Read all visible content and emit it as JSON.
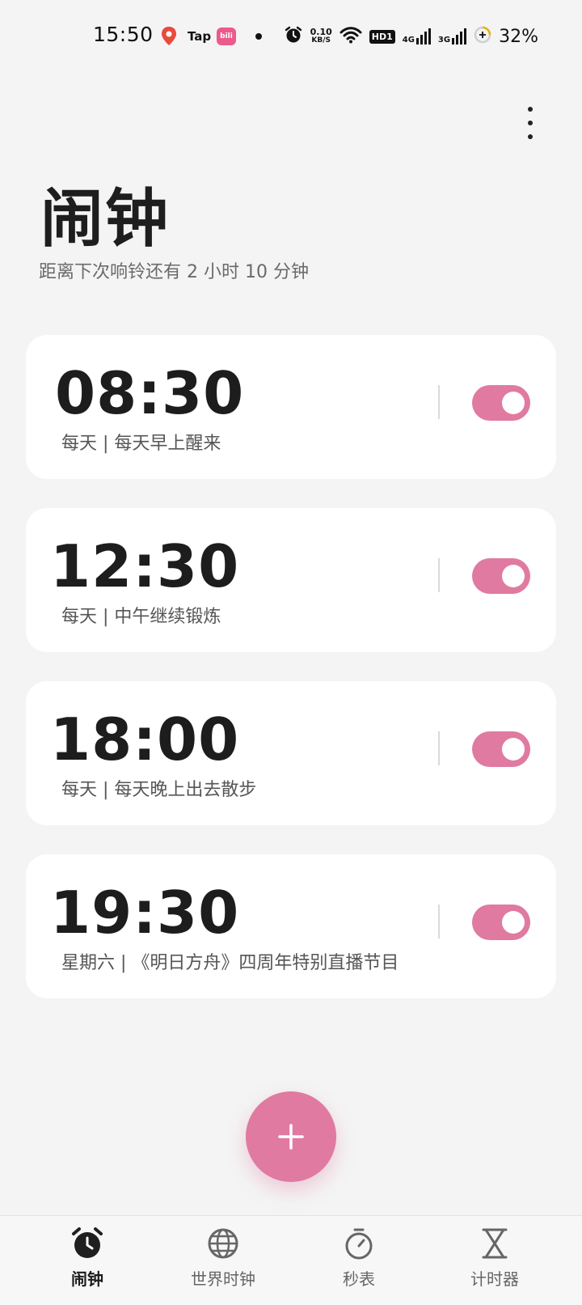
{
  "status_bar": {
    "time": "15:50",
    "tap_label": "Tap",
    "bili_label": "bili",
    "net_speed_value": "0.10",
    "net_speed_unit": "KB/S",
    "hd_label": "HD1",
    "signal1_label": "4G",
    "signal2_label": "3G",
    "battery": "32%"
  },
  "header": {
    "title": "闹钟",
    "subtitle": "距离下次响铃还有 2 小时 10 分钟"
  },
  "alarms": [
    {
      "time": "08:30",
      "label": "每天 | 每天早上醒来",
      "enabled": true
    },
    {
      "time": "12:30",
      "label": "每天 | 中午继续锻炼",
      "enabled": true
    },
    {
      "time": "18:00",
      "label": "每天 | 每天晚上出去散步",
      "enabled": true
    },
    {
      "time": "19:30",
      "label": "星期六 | 《明日方舟》四周年特别直播节目",
      "enabled": true
    }
  ],
  "nav": {
    "items": [
      {
        "label": "闹钟",
        "icon": "alarm-clock-icon",
        "active": true
      },
      {
        "label": "世界时钟",
        "icon": "globe-icon",
        "active": false
      },
      {
        "label": "秒表",
        "icon": "stopwatch-icon",
        "active": false
      },
      {
        "label": "计时器",
        "icon": "hourglass-icon",
        "active": false
      }
    ]
  },
  "colors": {
    "accent": "#e07aa0",
    "background": "#f4f4f4",
    "card": "#ffffff"
  }
}
